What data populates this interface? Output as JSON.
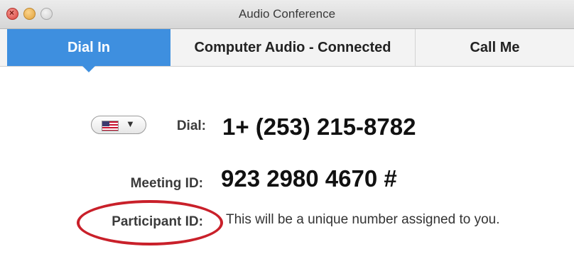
{
  "window": {
    "title": "Audio Conference"
  },
  "tabs": [
    {
      "label": "Dial In",
      "active": true
    },
    {
      "label": "Computer Audio - Connected",
      "active": false
    },
    {
      "label": "Call Me",
      "active": false
    }
  ],
  "country_selector": {
    "flag": "us-flag-icon",
    "caret": "▼"
  },
  "dial": {
    "label": "Dial:",
    "value": "1+ (253) 215-8782"
  },
  "meeting": {
    "label": "Meeting ID:",
    "value": "923 2980 4670 #"
  },
  "participant": {
    "label": "Participant ID:",
    "value": "This will be a unique number assigned to you."
  },
  "colors": {
    "accent": "#3e8fdf",
    "annotation": "#c9202a"
  }
}
